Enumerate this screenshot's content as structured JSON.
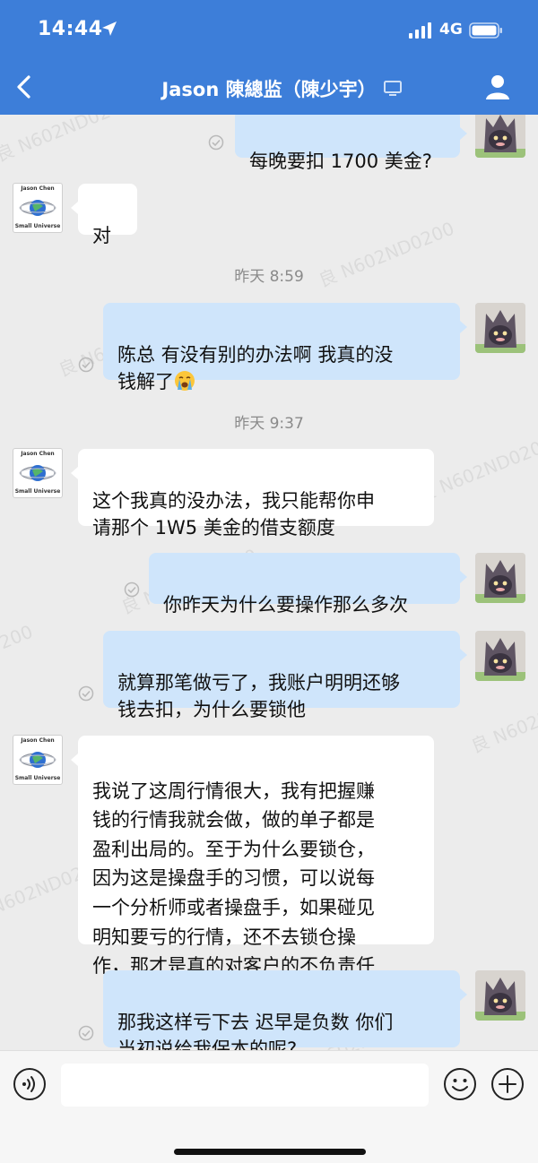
{
  "status_bar": {
    "time": "14:44",
    "network": "4G"
  },
  "header": {
    "title": "Jason 陳總监（陳少宇）"
  },
  "messages": [
    {
      "side": "out",
      "text": "每晚要扣 1700 美金?"
    },
    {
      "side": "in",
      "text": "对"
    },
    {
      "timestamp": "昨天 8:59"
    },
    {
      "side": "out",
      "text": "陈总 有没有别的办法啊 我真的没\n钱解了",
      "emoji": "crying-emoji"
    },
    {
      "timestamp": "昨天 9:37"
    },
    {
      "side": "in",
      "text": "这个我真的没办法，我只能帮你申\n请那个 1W5 美金的借支额度"
    },
    {
      "side": "out",
      "text": "你昨天为什么要操作那么多次"
    },
    {
      "side": "out",
      "text": "就算那笔做亏了，我账户明明还够\n钱去扣，为什么要锁他"
    },
    {
      "side": "in",
      "text": "我说了这周行情很大，我有把握赚\n钱的行情我就会做，做的单子都是\n盈利出局的。至于为什么要锁仓，\n因为这是操盘手的习惯，可以说每\n一个分析师或者操盘手，如果碰见\n明知要亏的行情，还不去锁仓操\n作，那才是真的对客户的不负责任"
    },
    {
      "side": "out",
      "text": "那我这样亏下去 迟早是负数 你们\n当初说给我保本的呢?"
    }
  ],
  "contact_avatar": {
    "top_text": "Jason Chen",
    "bottom_text": "Small Universe"
  },
  "watermark_text": "良 N602ND0200",
  "input": {
    "placeholder": ""
  },
  "icons": {
    "back": "chevron-left-icon",
    "computer": "computer-icon",
    "profile": "person-icon",
    "voice": "voice-icon",
    "emoji": "smiley-icon",
    "plus": "plus-icon",
    "read": "check-circle-icon"
  },
  "colors": {
    "header": "#3d7ed9",
    "bubble_out": "#cfe5fb",
    "bubble_in": "#ffffff",
    "background": "#ececec"
  }
}
